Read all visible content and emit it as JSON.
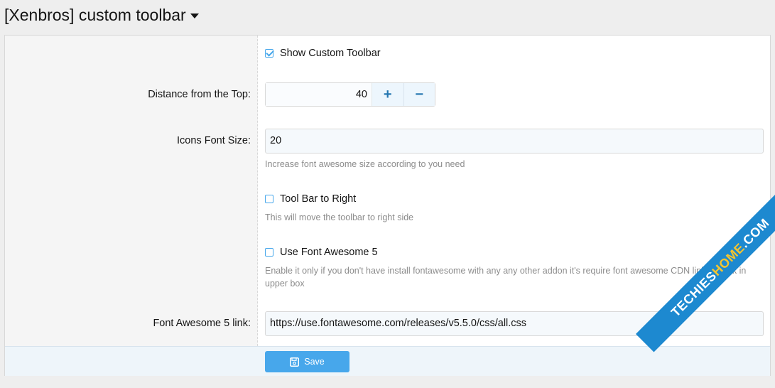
{
  "page": {
    "title": "[Xenbros] custom toolbar"
  },
  "form": {
    "show_toolbar": {
      "label": "Show Custom Toolbar",
      "checked": true
    },
    "distance": {
      "label": "Distance from the Top:",
      "value": "40",
      "increment_label": "+",
      "decrement_label": "−"
    },
    "icons_size": {
      "label": "Icons Font Size:",
      "value": "20",
      "hint": "Increase font awesome size according to you need"
    },
    "toolbar_right": {
      "label": "Tool Bar to Right",
      "checked": false,
      "hint": "This will move the toolbar to right side"
    },
    "use_fa5": {
      "label": "Use Font Awesome 5",
      "checked": false,
      "hint": "Enable it only if you don't have install fontawesome with any any other addon it's require font awesome CDN link to work in upper box"
    },
    "fa5_link": {
      "label": "Font Awesome 5 link:",
      "value": "https://use.fontawesome.com/releases/v5.5.0/css/all.css"
    },
    "save_label": "Save"
  },
  "watermark": {
    "text_a": "TECHIES",
    "text_b": "HOME",
    "text_c": ".COM"
  },
  "colors": {
    "accent": "#47a7eb",
    "button_text": "#ffffff",
    "hint_text": "#8c8c8c"
  }
}
